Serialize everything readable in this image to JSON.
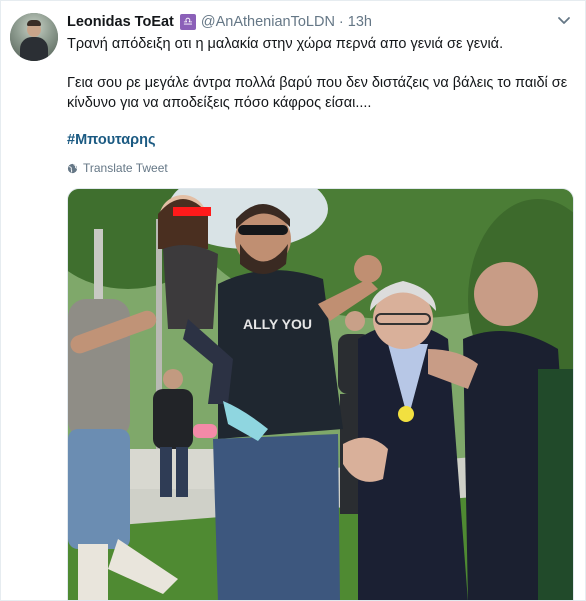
{
  "tweet": {
    "author_name": "Leonidas ToEat",
    "badge_glyph": "♎",
    "handle": "@AnAthenianToLDN",
    "separator": "·",
    "time": "13h",
    "text_line1": "Τρανή απόδειξη οτι η μαλακία στην χώρα περνά απο γενιά σε γενιά.",
    "text_line2": "Γεια σου ρε μεγάλε άντρα πολλά βαρύ που δεν διστάζεις να βάλεις το παιδί σε κίνδυνο για να αποδείξεις πόσο κάφρος είσαι....",
    "hashtag": "#Μπουταρης",
    "translate_label": "Translate Tweet",
    "photo_shirt_text": "ALLY YOU"
  },
  "icons": {
    "avatar": "user-avatar",
    "caret": "chevron-down-icon",
    "globe": "globe-icon"
  },
  "colors": {
    "text": "#14171a",
    "muted": "#657786",
    "hashtag": "#1b5a82",
    "badge": "#8b60b8"
  }
}
